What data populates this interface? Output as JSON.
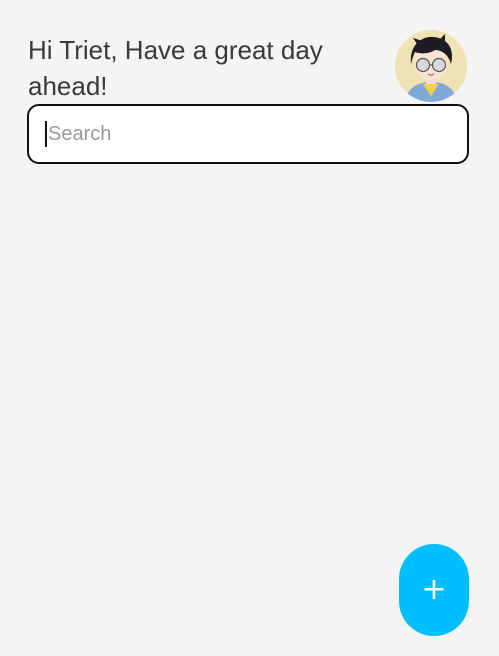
{
  "header": {
    "greeting": "Hi Triet, Have a great day ahead!"
  },
  "search": {
    "placeholder": "Search",
    "value": ""
  },
  "fab": {
    "icon": "plus-icon",
    "label": "+"
  },
  "colors": {
    "background": "#f4f4f4",
    "accent": "#00bfff",
    "input_border": "#111111"
  }
}
